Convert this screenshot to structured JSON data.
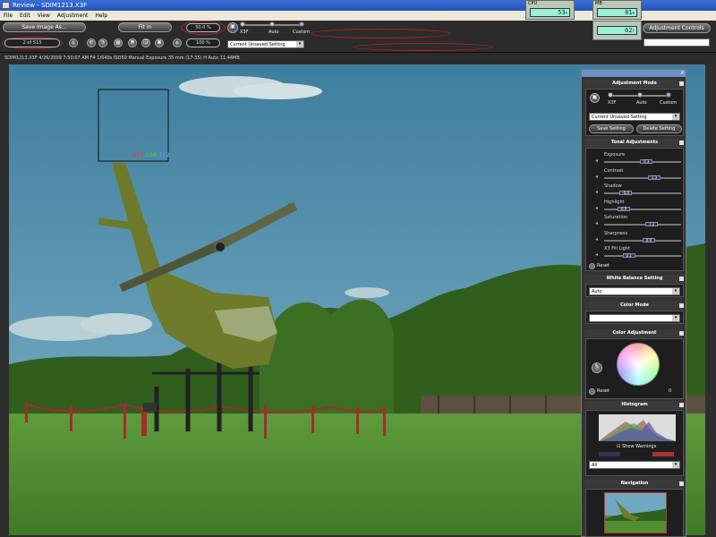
{
  "window": {
    "title": "Review - SDIM1213.X3F"
  },
  "menu": {
    "items": [
      "File",
      "Edit",
      "View",
      "Adjustment",
      "Help"
    ]
  },
  "toolbar": {
    "save_image_as": "Save Image As...",
    "fit_in": "Fit in",
    "zoom_value": "50.0 %",
    "page_index": "2 of 513",
    "rotate_value": "100 %",
    "mode_labels": [
      "X3F",
      "Auto",
      "Custom"
    ],
    "setting_select": "Current Unsaved Setting",
    "adjustment_controls": "Adjustment Controls"
  },
  "gauges": {
    "cpu": {
      "label": "CPU",
      "value": "53",
      "unit": "%"
    },
    "mb": {
      "label": "MB",
      "value": "81",
      "unit": "%"
    },
    "mb2": {
      "label": "",
      "value": "62",
      "unit": "F"
    }
  },
  "infobar": {
    "text": "SDIM1213.X3F  4/26/2009  7:50:07 AM  F4  1/640s  ISO50  Manual Exposure  35 mm (17-35)  H  Auto  11.44MB"
  },
  "loupe": {
    "r": "101",
    "g": "150",
    "b": "172"
  },
  "panel": {
    "adjustment_mode": {
      "title": "Adjustment Mode",
      "modes": [
        "X3F",
        "Auto",
        "Custom"
      ],
      "setting": "Current Unsaved Setting",
      "save_setting": "Save Setting",
      "delete_setting": "Delete Setting"
    },
    "tonal": {
      "title": "Tonal Adjustments",
      "rows": [
        {
          "label": "Exposure",
          "value": "0.3",
          "level": 0.55
        },
        {
          "label": "Contrast",
          "value": "1.3",
          "level": 0.65
        },
        {
          "label": "Shadow",
          "value": "-0.8",
          "level": 0.28
        },
        {
          "label": "Highlight",
          "value": "-0.9",
          "level": 0.25
        },
        {
          "label": "Saturation",
          "value": "1.2",
          "level": 0.62
        },
        {
          "label": "Sharpness",
          "value": "0.9",
          "level": 0.58
        },
        {
          "label": "X3 Fill Light",
          "value": "0.1",
          "level": 0.32
        }
      ],
      "reset": "Reset"
    },
    "white_balance": {
      "title": "White Balance Setting",
      "value": "Auto"
    },
    "color_mode": {
      "title": "Color Mode",
      "value": ""
    },
    "color_adjustment": {
      "title": "Color Adjustment",
      "reset": "Reset",
      "value": "0"
    },
    "histogram": {
      "title": "Histogram",
      "show_warnings": "Show Warnings",
      "channel": "All"
    },
    "navigation": {
      "title": "Navigation"
    }
  },
  "colors": {
    "titlebar": "#2452b8",
    "panel_header": "#6f8fc9",
    "loupe_r": "#e04040",
    "loupe_g": "#40c040",
    "loupe_b": "#6090ff"
  }
}
